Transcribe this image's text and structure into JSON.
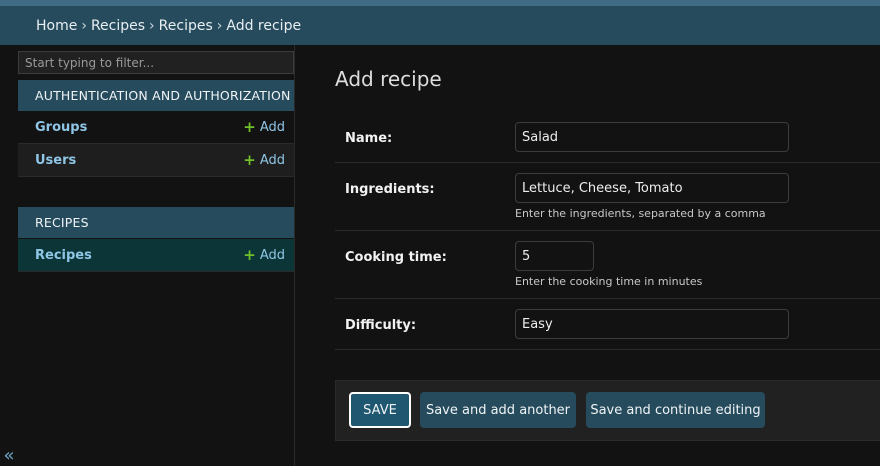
{
  "breadcrumbs": {
    "items": [
      "Home",
      "Recipes",
      "Recipes",
      "Add recipe"
    ],
    "separator": "›"
  },
  "sidebar": {
    "filter_placeholder": "Start typing to filter...",
    "collapse_icon": "«",
    "modules": [
      {
        "caption": "AUTHENTICATION AND AUTHORIZATION",
        "models": [
          {
            "name": "Groups",
            "add_label": "Add"
          },
          {
            "name": "Users",
            "add_label": "Add"
          }
        ]
      },
      {
        "caption": "RECIPES",
        "models": [
          {
            "name": "Recipes",
            "add_label": "Add",
            "selected": true
          }
        ]
      }
    ]
  },
  "main": {
    "title": "Add recipe",
    "fields": {
      "name": {
        "label": "Name:",
        "value": "Salad"
      },
      "ingredients": {
        "label": "Ingredients:",
        "value": "Lettuce, Cheese, Tomato",
        "help": "Enter the ingredients, separated by a comma"
      },
      "cooking_time": {
        "label": "Cooking time:",
        "value": "5",
        "help": "Enter the cooking time in minutes"
      },
      "difficulty": {
        "label": "Difficulty:",
        "value": "Easy"
      }
    },
    "buttons": {
      "save": "SAVE",
      "save_add_another": "Save and add another",
      "save_continue": "Save and continue editing"
    }
  },
  "colors": {
    "header": "#264b5d",
    "link": "#8fc6e6",
    "add_plus": "#70bf2b",
    "selected_row": "#0c3537"
  }
}
